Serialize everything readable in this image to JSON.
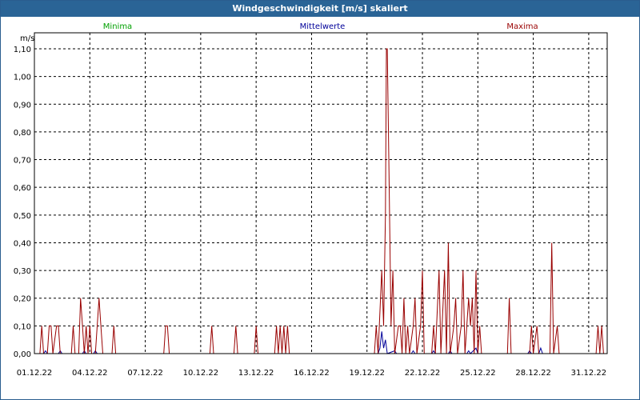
{
  "window": {
    "title": "Windgeschwindigkeit [m/s] skaliert"
  },
  "colors": {
    "minima": "#00a000",
    "mittel": "#000099",
    "maxima": "#990000",
    "grid": "#000000",
    "titlebar": "#2a6496"
  },
  "chart_data": {
    "type": "line",
    "title": "Windgeschwindigkeit [m/s] skaliert",
    "ylabel": "m/s",
    "xlabel": "",
    "ylim": [
      0,
      1.15
    ],
    "y_ticks": [
      "0,00",
      "0,10",
      "0,20",
      "0,30",
      "0,40",
      "0,50",
      "0,60",
      "0,70",
      "0,80",
      "0,90",
      "1,00",
      "1,10"
    ],
    "y_tick_values": [
      0,
      0.1,
      0.2,
      0.3,
      0.4,
      0.5,
      0.6,
      0.7,
      0.8,
      0.9,
      1.0,
      1.1
    ],
    "x_range_days": [
      1,
      32
    ],
    "x_ticks": [
      "01.12.22",
      "04.12.22",
      "07.12.22",
      "10.12.22",
      "13.12.22",
      "16.12.22",
      "19.12.22",
      "22.12.22",
      "25.12.22",
      "28.12.22",
      "31.12.22"
    ],
    "x_tick_values": [
      1,
      4,
      7,
      10,
      13,
      16,
      19,
      22,
      25,
      28,
      31
    ],
    "grid": true,
    "legend_placement": "top",
    "series": [
      {
        "name": "Minima",
        "color": "#00a000",
        "points": [
          [
            1,
            0
          ],
          [
            32,
            0
          ]
        ]
      },
      {
        "name": "Mittelwerte",
        "color": "#000099",
        "points": [
          [
            1,
            0
          ],
          [
            1.5,
            0
          ],
          [
            1.6,
            0.01
          ],
          [
            1.7,
            0
          ],
          [
            2.3,
            0
          ],
          [
            2.4,
            0.01
          ],
          [
            2.5,
            0
          ],
          [
            3.6,
            0
          ],
          [
            3.7,
            0.01
          ],
          [
            3.8,
            0
          ],
          [
            4.2,
            0
          ],
          [
            4.3,
            0.01
          ],
          [
            4.4,
            0
          ],
          [
            19.6,
            0
          ],
          [
            19.7,
            0.02
          ],
          [
            19.8,
            0.08
          ],
          [
            19.9,
            0.02
          ],
          [
            20.0,
            0.05
          ],
          [
            20.1,
            0
          ],
          [
            20.5,
            0.01
          ],
          [
            20.6,
            0
          ],
          [
            21.4,
            0
          ],
          [
            21.5,
            0.01
          ],
          [
            21.6,
            0
          ],
          [
            22.5,
            0
          ],
          [
            22.6,
            0.01
          ],
          [
            22.7,
            0
          ],
          [
            23.4,
            0
          ],
          [
            23.5,
            0.01
          ],
          [
            23.6,
            0
          ],
          [
            24.4,
            0
          ],
          [
            24.5,
            0.01
          ],
          [
            24.6,
            0
          ],
          [
            24.9,
            0.02
          ],
          [
            25.0,
            0
          ],
          [
            27.7,
            0
          ],
          [
            27.8,
            0.01
          ],
          [
            27.9,
            0
          ],
          [
            28.3,
            0
          ],
          [
            28.4,
            0.02
          ],
          [
            28.5,
            0
          ],
          [
            32,
            0
          ]
        ]
      },
      {
        "name": "Maxima",
        "color": "#990000",
        "points": [
          [
            1,
            0
          ],
          [
            1.3,
            0
          ],
          [
            1.4,
            0.1
          ],
          [
            1.5,
            0
          ],
          [
            1.7,
            0
          ],
          [
            1.8,
            0.1
          ],
          [
            1.9,
            0.1
          ],
          [
            2.0,
            0
          ],
          [
            2.2,
            0.1
          ],
          [
            2.3,
            0.1
          ],
          [
            2.4,
            0
          ],
          [
            3.0,
            0
          ],
          [
            3.1,
            0.1
          ],
          [
            3.2,
            0
          ],
          [
            3.4,
            0
          ],
          [
            3.5,
            0.2
          ],
          [
            3.6,
            0.1
          ],
          [
            3.7,
            0
          ],
          [
            3.8,
            0.1
          ],
          [
            3.9,
            0
          ],
          [
            4.0,
            0.1
          ],
          [
            4.1,
            0
          ],
          [
            4.3,
            0
          ],
          [
            4.4,
            0.1
          ],
          [
            4.5,
            0.2
          ],
          [
            4.6,
            0.1
          ],
          [
            4.7,
            0
          ],
          [
            5.2,
            0
          ],
          [
            5.3,
            0.1
          ],
          [
            5.4,
            0
          ],
          [
            8.0,
            0
          ],
          [
            8.1,
            0.1
          ],
          [
            8.2,
            0.1
          ],
          [
            8.3,
            0
          ],
          [
            10.5,
            0
          ],
          [
            10.6,
            0.1
          ],
          [
            10.7,
            0
          ],
          [
            11.8,
            0
          ],
          [
            11.9,
            0.1
          ],
          [
            12.0,
            0
          ],
          [
            12.9,
            0
          ],
          [
            13.0,
            0.1
          ],
          [
            13.1,
            0
          ],
          [
            14.0,
            0
          ],
          [
            14.1,
            0.1
          ],
          [
            14.2,
            0
          ],
          [
            14.3,
            0.1
          ],
          [
            14.4,
            0
          ],
          [
            14.5,
            0.1
          ],
          [
            14.6,
            0
          ],
          [
            14.7,
            0.1
          ],
          [
            14.8,
            0
          ],
          [
            19.4,
            0
          ],
          [
            19.5,
            0.1
          ],
          [
            19.6,
            0
          ],
          [
            19.8,
            0.3
          ],
          [
            19.9,
            0.1
          ],
          [
            20.0,
            0.5
          ],
          [
            20.05,
            1.1
          ],
          [
            20.1,
            1.1
          ],
          [
            20.2,
            0.6
          ],
          [
            20.3,
            0.1
          ],
          [
            20.4,
            0.3
          ],
          [
            20.5,
            0
          ],
          [
            20.7,
            0.1
          ],
          [
            20.8,
            0.1
          ],
          [
            20.9,
            0
          ],
          [
            21.0,
            0.2
          ],
          [
            21.1,
            0
          ],
          [
            21.2,
            0.1
          ],
          [
            21.3,
            0
          ],
          [
            21.5,
            0.1
          ],
          [
            21.6,
            0.2
          ],
          [
            21.7,
            0
          ],
          [
            21.9,
            0.1
          ],
          [
            22.0,
            0.3
          ],
          [
            22.1,
            0
          ],
          [
            22.5,
            0
          ],
          [
            22.6,
            0.1
          ],
          [
            22.7,
            0
          ],
          [
            22.9,
            0.3
          ],
          [
            23.0,
            0
          ],
          [
            23.2,
            0.3
          ],
          [
            23.3,
            0
          ],
          [
            23.4,
            0.4
          ],
          [
            23.5,
            0
          ],
          [
            23.7,
            0.1
          ],
          [
            23.8,
            0.2
          ],
          [
            23.9,
            0
          ],
          [
            24.1,
            0.1
          ],
          [
            24.2,
            0.3
          ],
          [
            24.3,
            0
          ],
          [
            24.5,
            0.2
          ],
          [
            24.6,
            0.1
          ],
          [
            24.7,
            0.2
          ],
          [
            24.8,
            0
          ],
          [
            24.9,
            0.3
          ],
          [
            25.0,
            0
          ],
          [
            25.1,
            0.1
          ],
          [
            25.2,
            0
          ],
          [
            26.6,
            0
          ],
          [
            26.7,
            0.2
          ],
          [
            26.8,
            0
          ],
          [
            27.8,
            0
          ],
          [
            27.9,
            0.1
          ],
          [
            28.0,
            0
          ],
          [
            28.2,
            0.1
          ],
          [
            28.3,
            0
          ],
          [
            28.9,
            0
          ],
          [
            29.0,
            0.4
          ],
          [
            29.1,
            0
          ],
          [
            29.3,
            0.1
          ],
          [
            29.4,
            0
          ],
          [
            31.4,
            0
          ],
          [
            31.5,
            0.1
          ],
          [
            31.6,
            0
          ],
          [
            31.7,
            0.1
          ],
          [
            31.8,
            0
          ],
          [
            32,
            0
          ]
        ]
      }
    ]
  }
}
